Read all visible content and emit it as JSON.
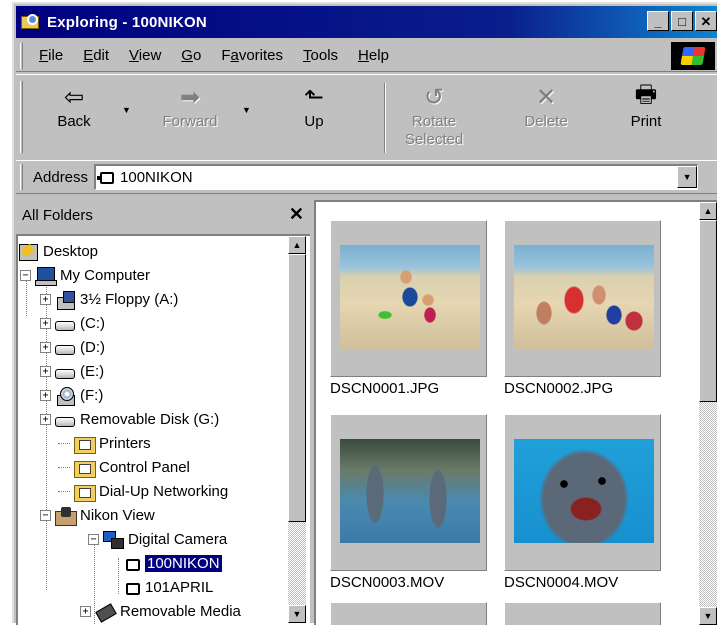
{
  "window": {
    "title": "Exploring - 100NIKON",
    "buttons": {
      "minimize": "_",
      "maximize": "□",
      "close": "✕"
    }
  },
  "menu": {
    "items": [
      {
        "label": "File",
        "accel": "F",
        "rest": "ile"
      },
      {
        "label": "Edit",
        "accel": "E",
        "rest": "dit"
      },
      {
        "label": "View",
        "accel": "V",
        "rest": "iew"
      },
      {
        "label": "Go",
        "accel": "G",
        "rest": "o"
      },
      {
        "label": "Favorites",
        "pre": "F",
        "accel": "a",
        "rest": "vorites"
      },
      {
        "label": "Tools",
        "accel": "T",
        "rest": "ools"
      },
      {
        "label": "Help",
        "accel": "H",
        "rest": "elp"
      }
    ]
  },
  "toolbar": {
    "back": {
      "label": "Back",
      "icon": "back-arrow-icon",
      "glyph": "⇦"
    },
    "forward": {
      "label": "Forward",
      "icon": "forward-arrow-icon",
      "glyph": "➡"
    },
    "up": {
      "label": "Up",
      "icon": "up-folder-icon",
      "glyph": "⬑"
    },
    "rotate": {
      "label": "Rotate\nSelected",
      "icon": "rotate-icon",
      "glyph": "↺"
    },
    "delete": {
      "label": "Delete",
      "icon": "delete-x-icon",
      "glyph": "✕"
    },
    "print": {
      "label": "Print",
      "icon": "printer-icon",
      "glyph": "🖶"
    },
    "dropdown_glyph": "▼"
  },
  "address": {
    "label": "Address",
    "value": "100NIKON",
    "drop_glyph": "▼"
  },
  "folders": {
    "header": "All Folders",
    "close_glyph": "✕",
    "items": [
      {
        "label": "Desktop"
      },
      {
        "label": "My Computer",
        "expander": "−"
      },
      {
        "label": "3½ Floppy (A:)",
        "expander": "+"
      },
      {
        "label": "(C:)",
        "expander": "+"
      },
      {
        "label": "(D:)",
        "expander": "+"
      },
      {
        "label": "(E:)",
        "expander": "+"
      },
      {
        "label": "(F:)",
        "expander": "+"
      },
      {
        "label": "Removable Disk (G:)",
        "expander": "+"
      },
      {
        "label": "Printers"
      },
      {
        "label": "Control Panel"
      },
      {
        "label": "Dial-Up Networking"
      },
      {
        "label": "Nikon View",
        "expander": "−"
      },
      {
        "label": "Digital Camera",
        "expander": "−"
      },
      {
        "label": "100NIKON",
        "selected": true
      },
      {
        "label": "101APRIL"
      },
      {
        "label": "Removable Media",
        "expander": "+"
      }
    ]
  },
  "files": [
    {
      "name": "DSCN0001.JPG"
    },
    {
      "name": "DSCN0002.JPG"
    },
    {
      "name": "DSCN0003.MOV"
    },
    {
      "name": "DSCN0004.MOV"
    }
  ],
  "scroll": {
    "up": "▲",
    "down": "▼"
  },
  "colors": {
    "title_bar": "#000080",
    "selection": "#000080",
    "chrome": "#c0c0c0"
  }
}
